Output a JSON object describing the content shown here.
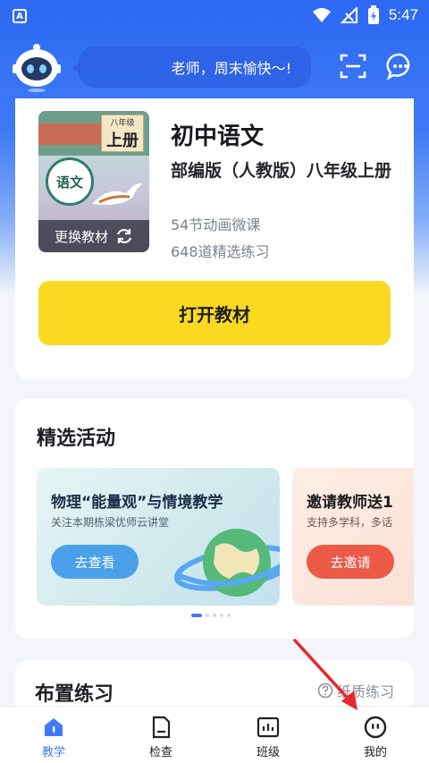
{
  "status_bar": {
    "app_badge": "A",
    "time": "5:47",
    "icons": [
      "wifi-icon",
      "signal-icon",
      "battery-charging-icon"
    ]
  },
  "header": {
    "greeting": "老师，周末愉快～!",
    "icons": [
      "robot-avatar-icon",
      "scan-icon",
      "message-icon"
    ]
  },
  "textbook": {
    "cover_grade": "八年级",
    "cover_volume": "上册",
    "cover_seal": "语文",
    "change_label": "更换教材",
    "subject": "初中语文",
    "edition": "部编版（人教版）八年级上册",
    "lessons": "54节动画微课",
    "exercises": "648道精选练习",
    "open_label": "打开教材"
  },
  "activities": {
    "title": "精选活动",
    "banners": [
      {
        "title": "物理“能量观”与情境教学",
        "subtitle": "关注本期栋梁优师云讲堂",
        "button": "去查看"
      },
      {
        "title": "邀请教师送1",
        "subtitle": "支持多学科，多话",
        "button": "去邀请"
      }
    ],
    "page_count": 5,
    "active_page": 1
  },
  "practice": {
    "title": "布置练习",
    "paper_link": "纸质练习"
  },
  "tabs": [
    {
      "label": "教学",
      "icon": "teach-icon",
      "active": true
    },
    {
      "label": "检查",
      "icon": "check-icon",
      "active": false
    },
    {
      "label": "班级",
      "icon": "class-icon",
      "active": false
    },
    {
      "label": "我的",
      "icon": "profile-icon",
      "active": false
    }
  ],
  "colors": {
    "primary": "#3f7bf6",
    "open_button": "#fbd921",
    "invite_button": "#ea5a47",
    "view_button": "#4aa1ea"
  }
}
